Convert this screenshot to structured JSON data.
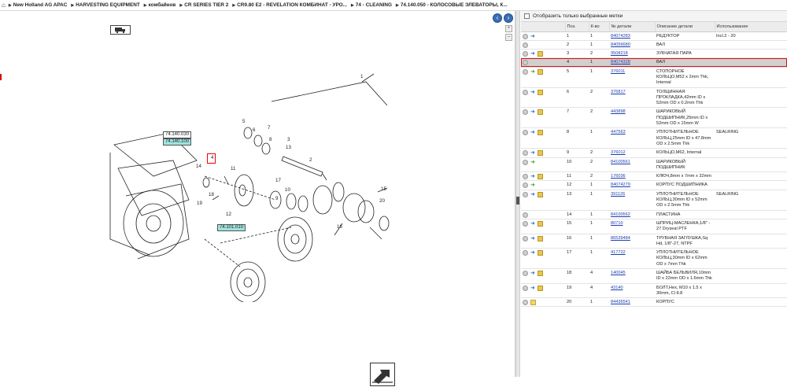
{
  "breadcrumb": [
    {
      "label": "New Holland AG APAC"
    },
    {
      "label": "HARVESTING EQUIPMENT"
    },
    {
      "label": "комбайнов"
    },
    {
      "label": "CR SERIES TIER 2"
    },
    {
      "label": "CR9.80 E2 - REVELATION КОМБИНАТ - УРО..."
    },
    {
      "label": "74 - CLEANING"
    },
    {
      "label": "74.140.050 - КОЛОСОВЫЕ ЭЛЕВАТОРЫ, К..."
    }
  ],
  "diagram": {
    "callouts": [
      {
        "label": "74.140.030",
        "highlight": false
      },
      {
        "label": "74.140.100",
        "highlight": true
      },
      {
        "label": "74.101.010",
        "highlight": true
      }
    ],
    "part_numbers": [
      "1",
      "2",
      "3",
      "4",
      "5",
      "6",
      "7",
      "8",
      "9",
      "10",
      "11",
      "12",
      "13",
      "14",
      "15",
      "16",
      "17",
      "18",
      "19",
      "20"
    ]
  },
  "filter": {
    "label": "Отобразить только выбранные метки"
  },
  "table": {
    "headers": [
      "Поз.",
      "К-во",
      "№ детали",
      "Описание детали",
      "Использование"
    ],
    "rows": [
      {
        "pos": "1",
        "qty": "1",
        "part": "84074283",
        "desc": "РЕДУКТОР",
        "use": "Incl.2 - 20",
        "icons": [
          "plus",
          "cart"
        ],
        "selected": false
      },
      {
        "pos": "2",
        "qty": "1",
        "part": "84056680",
        "desc": "ВАЛ",
        "use": "",
        "icons": [
          "plus"
        ],
        "selected": false
      },
      {
        "pos": "3",
        "qty": "2",
        "part": "9508218",
        "desc": "ЗУБЧАТАЯ ПАРА",
        "use": "",
        "icons": [
          "plus",
          "cart",
          "box"
        ],
        "selected": false
      },
      {
        "pos": "4",
        "qty": "1",
        "part": "84074328",
        "desc": "ВАЛ",
        "use": "",
        "icons": [
          "plus"
        ],
        "selected": true
      },
      {
        "pos": "5",
        "qty": "1",
        "part": "376011",
        "desc": "СТОПОРНОЕ КОЛЬЦО,M52 x 2mm Thk, Internal",
        "use": "",
        "icons": [
          "plus",
          "cartg",
          "box"
        ],
        "selected": false
      },
      {
        "pos": "6",
        "qty": "2",
        "part": "376817",
        "desc": "ТОЛЩИННАЯ ПРОКЛАДКА,42mm ID x 52mm OD x 0.2mm Thk",
        "use": "",
        "icons": [
          "plus",
          "cart",
          "box"
        ],
        "selected": false
      },
      {
        "pos": "7",
        "qty": "2",
        "part": "443898",
        "desc": "ШАРИКОВЫЙ ПОДШИПНИК,25mm ID x 52mm OD x 15mm W",
        "use": "",
        "icons": [
          "plus",
          "cart",
          "box"
        ],
        "selected": false
      },
      {
        "pos": "8",
        "qty": "1",
        "part": "447563",
        "desc": "УПЛОТНИТЕЛЬНОЕ КОЛЬЦ,25mm ID x 47.8mm OD x 2.5mm Thk",
        "use": "SEALRING",
        "icons": [
          "plus",
          "cart",
          "box"
        ],
        "selected": false
      },
      {
        "pos": "9",
        "qty": "2",
        "part": "376012",
        "desc": "КОЛЬЦО,M62, Internal",
        "use": "",
        "icons": [
          "plus",
          "cart",
          "box"
        ],
        "selected": false
      },
      {
        "pos": "10",
        "qty": "2",
        "part": "84100561",
        "desc": "ШАРИКОВЫЙ ПОДШИПНИК",
        "use": "",
        "icons": [
          "plus",
          "cartg"
        ],
        "selected": false
      },
      {
        "pos": "11",
        "qty": "2",
        "part": "176036",
        "desc": "КЛЮЧ,8mm x 7mm x 32mm",
        "use": "",
        "icons": [
          "plus",
          "cart",
          "box"
        ],
        "selected": false
      },
      {
        "pos": "12",
        "qty": "1",
        "part": "84074279",
        "desc": "КОРПУС ПОДШИПНИКА",
        "use": "",
        "icons": [
          "plus",
          "cartg"
        ],
        "selected": false
      },
      {
        "pos": "13",
        "qty": "1",
        "part": "391126",
        "desc": "УПЛОТНИТЕЛЬНОЕ КОЛЬЦ,30mm ID x 52mm OD x 2.5mm Thk",
        "use": "SEALRING",
        "icons": [
          "plus",
          "cart",
          "box"
        ],
        "selected": false
      },
      {
        "pos": "14",
        "qty": "1",
        "part": "84100562",
        "desc": "ПЛАСТИНА",
        "use": "",
        "icons": [
          "plus"
        ],
        "selected": false
      },
      {
        "pos": "15",
        "qty": "1",
        "part": "80710",
        "desc": "ШПРИЦ-МАСЛЕНКА,1/8\" - 27 Dryseal PTF",
        "use": "",
        "icons": [
          "plus",
          "cart",
          "box"
        ],
        "selected": false
      },
      {
        "pos": "16",
        "qty": "1",
        "part": "86539484",
        "desc": "ТРУБНАЯ ЗАГЛУШКА,Sq Hd, 1/8\"-27, NTPF",
        "use": "",
        "icons": [
          "plus",
          "cart",
          "box"
        ],
        "selected": false
      },
      {
        "pos": "17",
        "qty": "1",
        "part": "417722",
        "desc": "УПЛОТНИТЕЛЬНОЕ КОЛЬЦ,30mm ID x 62mm OD x 7mm Thk",
        "use": "",
        "icons": [
          "plus",
          "cart",
          "box"
        ],
        "selected": false
      },
      {
        "pos": "18",
        "qty": "4",
        "part": "140045",
        "desc": "ШАЙБА БЕЛЬВИЛЯ,10mm ID x 22mm OD x 1.6mm Thk",
        "use": "",
        "icons": [
          "plus",
          "cart",
          "box"
        ],
        "selected": false
      },
      {
        "pos": "19",
        "qty": "4",
        "part": "43140",
        "desc": "БОЛТ,Hex, M10 x 1.5 x 30mm, Cl 8.8",
        "use": "",
        "icons": [
          "plus",
          "cart",
          "box"
        ],
        "selected": false
      },
      {
        "pos": "20",
        "qty": "1",
        "part": "84436541",
        "desc": "КОРПУС",
        "use": "",
        "icons": [
          "plus",
          "fold"
        ],
        "selected": false
      }
    ]
  }
}
